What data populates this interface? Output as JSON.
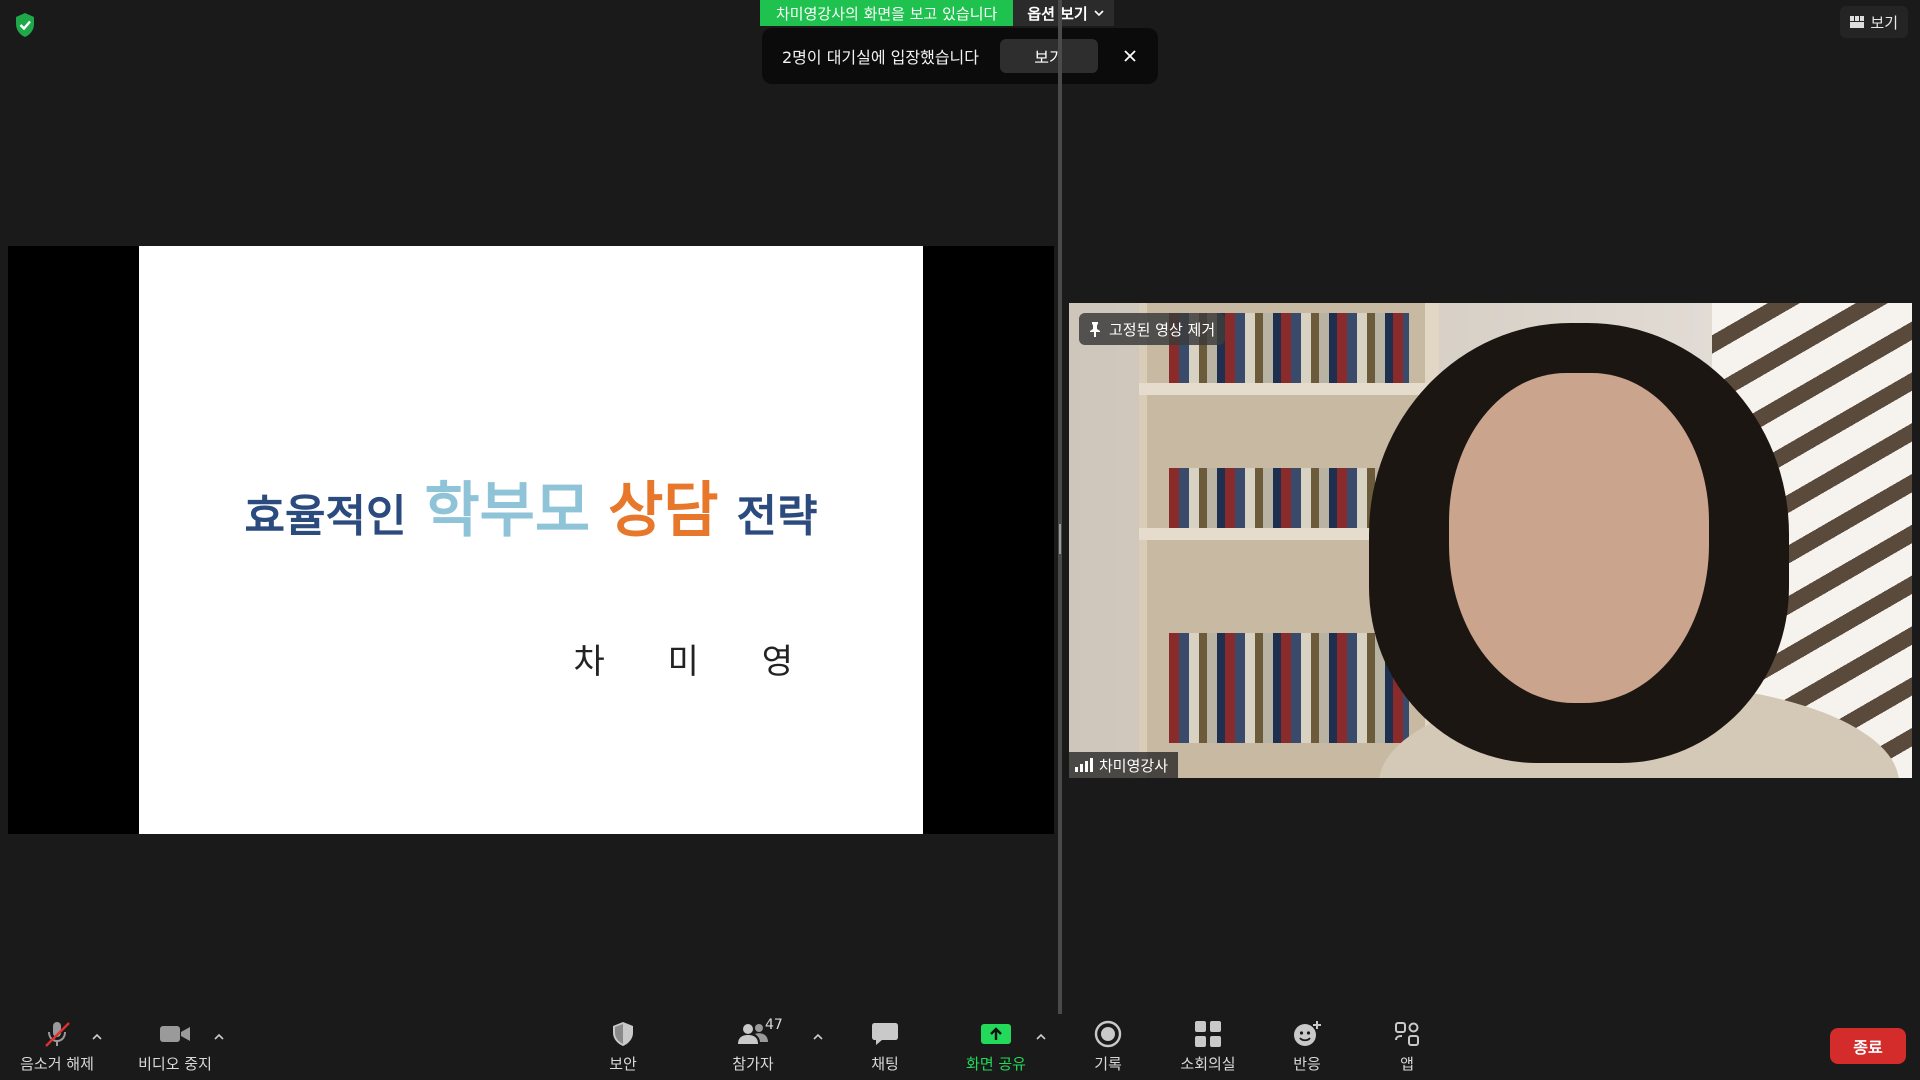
{
  "top": {
    "sharing_banner": "차미영강사의 화면을 보고 있습니다",
    "view_options_label": "옵션 보기",
    "view_label": "보기"
  },
  "notification": {
    "message": "2명이 대기실에 입장했습니다",
    "button_label": "보기"
  },
  "slide": {
    "title_part1": "효율적인",
    "title_part2": "학부모",
    "title_part3": "상담",
    "title_part4": "전략",
    "author": "차 미 영"
  },
  "video": {
    "pin_label": "고정된 영상 제거",
    "name": "차미영강사"
  },
  "toolbar": {
    "mute_label": "음소거 해제",
    "video_label": "비디오 중지",
    "security_label": "보안",
    "participants_label": "참가자",
    "participants_count": "47",
    "chat_label": "채팅",
    "share_label": "화면 공유",
    "record_label": "기록",
    "breakout_label": "소회의실",
    "reactions_label": "반응",
    "apps_label": "앱",
    "end_label": "종료"
  },
  "colors": {
    "share_green": "#23d959",
    "end_red": "#d42b2b",
    "slide_title_dark": "#2b4a7e",
    "slide_title_light": "#8fc3d8",
    "slide_title_orange": "#e7782b"
  }
}
